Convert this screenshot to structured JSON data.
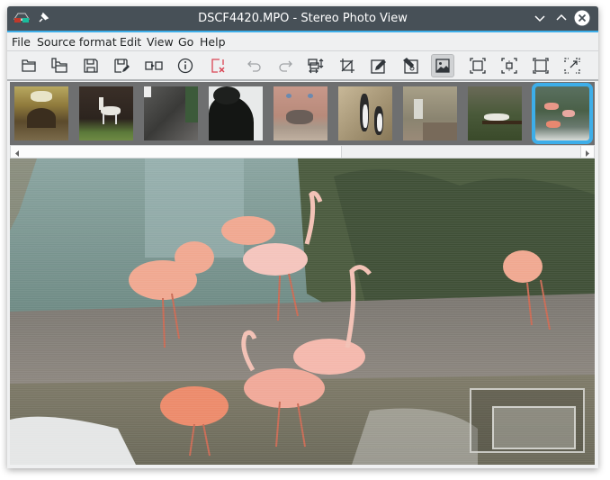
{
  "window": {
    "title": "DSCF4420.MPO - Stereo Photo View",
    "accent_color": "#3daee9",
    "titlebar_color": "#475057",
    "icons": {
      "app": "stereo-glasses-icon",
      "pin": "pin-icon",
      "minimize": "chevron-down-icon",
      "maximize": "chevron-up-icon",
      "close": "close-circle-icon"
    }
  },
  "menu": {
    "items": [
      "File",
      "Source format",
      "Edit",
      "View",
      "Go",
      "Help"
    ]
  },
  "toolbar": {
    "buttons": [
      {
        "name": "open",
        "icon": "folder-open-icon"
      },
      {
        "name": "open-pair",
        "icon": "folders-icon"
      },
      {
        "name": "save",
        "icon": "save-icon"
      },
      {
        "name": "save-as",
        "icon": "save-as-icon"
      },
      {
        "name": "swap",
        "icon": "swap-icon"
      },
      {
        "name": "info",
        "icon": "info-icon"
      },
      {
        "name": "delete",
        "icon": "delete-icon"
      },
      {
        "name": "undo",
        "icon": "undo-icon"
      },
      {
        "name": "redo",
        "icon": "redo-icon"
      },
      {
        "name": "align",
        "icon": "align-icon"
      },
      {
        "name": "crop",
        "icon": "crop-icon"
      },
      {
        "name": "edit-left",
        "icon": "edit-left-icon"
      },
      {
        "name": "edit-right",
        "icon": "edit-right-icon"
      },
      {
        "name": "view-image",
        "icon": "image-icon",
        "active": true
      },
      {
        "name": "fit-window",
        "icon": "fit-window-icon"
      },
      {
        "name": "zoom-center",
        "icon": "zoom-center-icon"
      },
      {
        "name": "full-size",
        "icon": "full-size-icon"
      },
      {
        "name": "fullscreen",
        "icon": "fullscreen-icon"
      }
    ]
  },
  "thumbnails": [
    {
      "label": "metro-station",
      "selected": false
    },
    {
      "label": "llama",
      "selected": false
    },
    {
      "label": "stone-sculpture",
      "selected": false
    },
    {
      "label": "dark-tree",
      "selected": false
    },
    {
      "label": "elephant",
      "selected": false
    },
    {
      "label": "penguins",
      "selected": false
    },
    {
      "label": "stone-enclosure",
      "selected": false
    },
    {
      "label": "white-tiger",
      "selected": false
    },
    {
      "label": "flamingos",
      "selected": true
    }
  ],
  "viewer": {
    "image_description": "Flamingos standing in water near trees (anaglyph/interlaced stereo view)"
  }
}
